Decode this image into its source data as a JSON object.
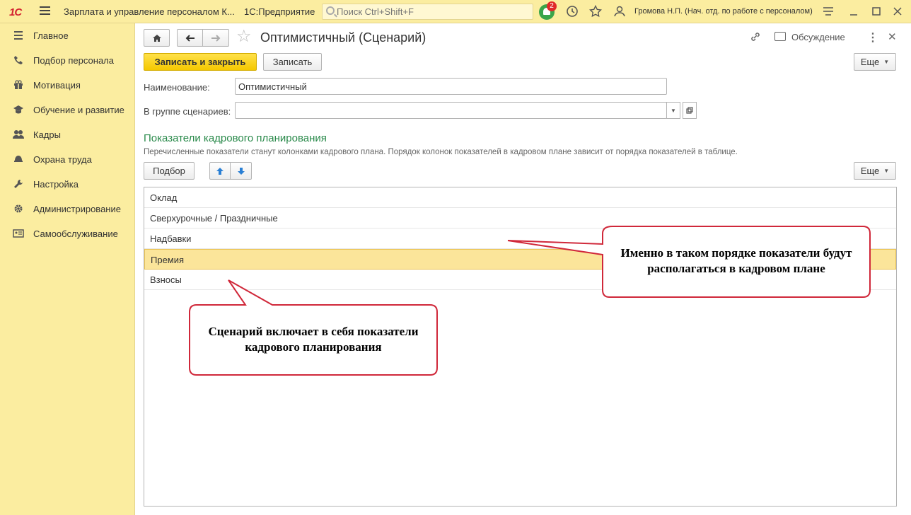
{
  "topbar": {
    "logo": "1С",
    "title": "Зарплата и управление персоналом К...",
    "app": "1С:Предприятие",
    "search_placeholder": "Поиск Ctrl+Shift+F",
    "notifications": "2",
    "user": "Громова Н.П. (Нач. отд. по работе с персоналом)"
  },
  "sidebar": {
    "items": [
      {
        "label": "Главное",
        "icon": "menu-icon"
      },
      {
        "label": "Подбор персонала",
        "icon": "phone-icon"
      },
      {
        "label": "Мотивация",
        "icon": "gift-icon"
      },
      {
        "label": "Обучение и развитие",
        "icon": "graduation-cap-icon"
      },
      {
        "label": "Кадры",
        "icon": "people-icon"
      },
      {
        "label": "Охрана труда",
        "icon": "helmet-icon"
      },
      {
        "label": "Настройка",
        "icon": "wrench-icon"
      },
      {
        "label": "Администрирование",
        "icon": "gear-icon"
      },
      {
        "label": "Самообслуживание",
        "icon": "id-card-icon"
      }
    ]
  },
  "form": {
    "title": "Оптимистичный (Сценарий)",
    "discussion": "Обсуждение",
    "save_close": "Записать и закрыть",
    "save": "Записать",
    "more": "Еще",
    "name_label": "Наименование:",
    "name_value": "Оптимистичный",
    "group_label": "В группе сценариев:",
    "group_value": "",
    "section_title": "Показатели кадрового планирования",
    "section_desc": "Перечисленные показатели станут колонками кадрового плана. Порядок колонок показателей в кадровом плане зависит от порядка показателей в таблице.",
    "pick": "Подбор",
    "rows": [
      "Оклад",
      "Сверхурочные / Праздничные",
      "Надбавки",
      "Премия",
      "Взносы"
    ],
    "selected_row": 3
  },
  "callouts": {
    "right": "Именно в таком порядке показатели будут располагаться в кадровом плане",
    "left": "Сценарий включает в себя показатели кадрового планирования"
  }
}
